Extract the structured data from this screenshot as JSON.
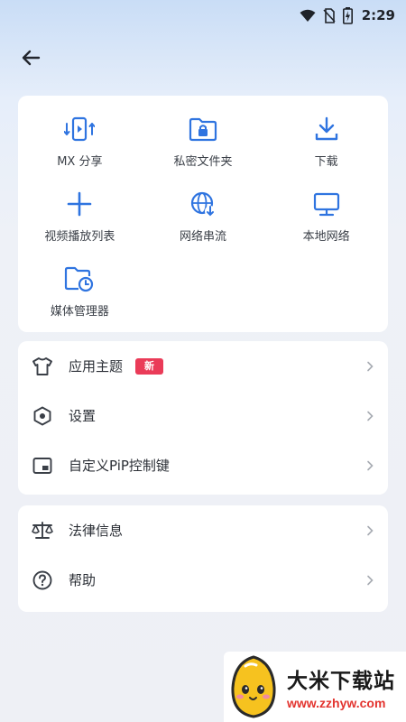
{
  "status_bar": {
    "time": "2:29",
    "icons": [
      "wifi-icon",
      "no-sim-icon",
      "battery-charging-icon"
    ]
  },
  "top_bar": {
    "back_icon": "back-arrow-icon"
  },
  "colors": {
    "accent": "#2f74e0",
    "badge": "#ea3b58",
    "text": "#2b2f36"
  },
  "grid": {
    "items": [
      {
        "label": "MX 分享",
        "icon": "share-transfer-icon"
      },
      {
        "label": "私密文件夹",
        "icon": "private-folder-icon"
      },
      {
        "label": "下载",
        "icon": "download-icon"
      },
      {
        "label": "视频播放列表",
        "icon": "add-playlist-icon"
      },
      {
        "label": "网络串流",
        "icon": "network-stream-icon"
      },
      {
        "label": "本地网络",
        "icon": "local-network-icon"
      },
      {
        "label": "媒体管理器",
        "icon": "media-manager-icon"
      }
    ]
  },
  "menu1": {
    "items": [
      {
        "label": "应用主题",
        "badge": "新",
        "icon": "tshirt-icon"
      },
      {
        "label": "设置",
        "icon": "settings-hex-icon"
      },
      {
        "label": "自定义PiP控制键",
        "icon": "pip-icon"
      }
    ]
  },
  "menu2": {
    "items": [
      {
        "label": "法律信息",
        "icon": "scales-icon"
      },
      {
        "label": "帮助",
        "icon": "help-icon"
      }
    ]
  },
  "watermark": {
    "title": "大米下载站",
    "url": "www.zzhyw.com"
  }
}
